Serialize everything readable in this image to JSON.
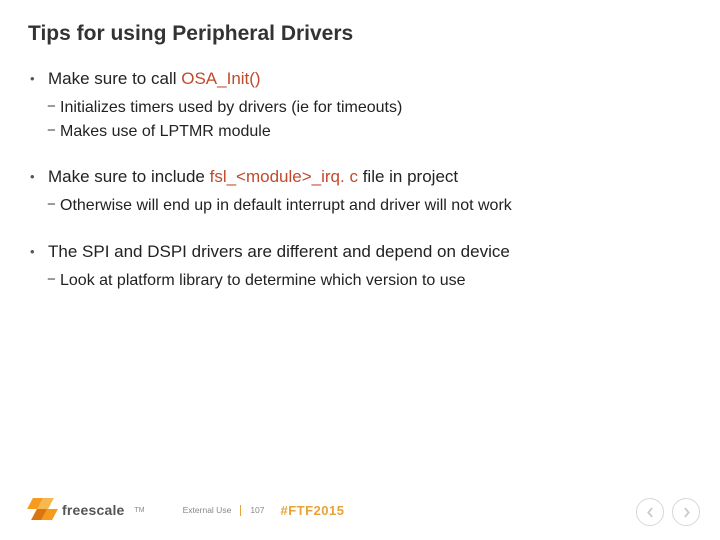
{
  "title": "Tips for using Peripheral Drivers",
  "g1": {
    "main_pre": "Make sure to call ",
    "main_code": "OSA_Init()",
    "s1": "Initializes timers used by drivers (ie for timeouts)",
    "s2": "Makes use of LPTMR module"
  },
  "g2": {
    "main_pre": "Make sure to include ",
    "main_code": "fsl_<module>_irq. c ",
    "main_post": "file in project",
    "s1": "Otherwise will end up in default interrupt and driver will not work"
  },
  "g3": {
    "main": "The SPI and DSPI drivers are different and depend on device",
    "s1": "Look at platform library to determine which version to use"
  },
  "footer": {
    "brand": "freescale",
    "tm": "TM",
    "external": "External Use",
    "page": "107",
    "hashtag": "#FTF2015"
  }
}
